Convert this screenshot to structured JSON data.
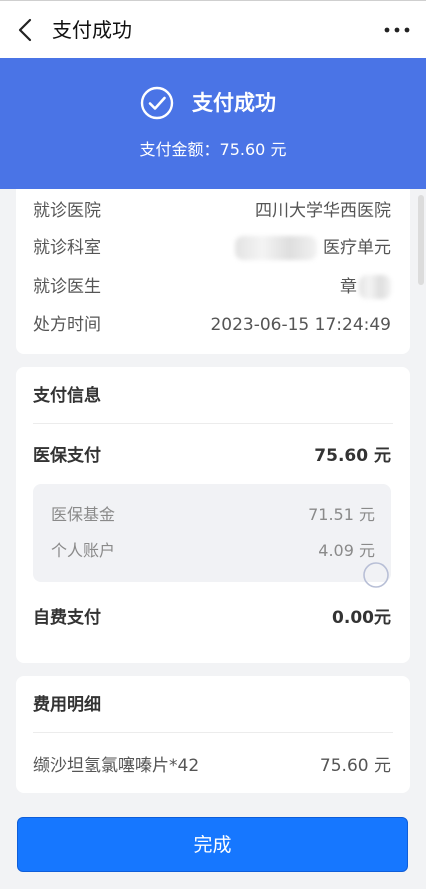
{
  "topbar": {
    "title": "支付成功",
    "back_icon": "chevron-left-icon",
    "more_icon": "more-dots-icon"
  },
  "banner": {
    "title": "支付成功",
    "amount_text": "支付金额：75.60 元",
    "background_color": "#4a74e6",
    "icon": "check-circle-icon"
  },
  "visit": {
    "rows": [
      {
        "label": "就诊医院",
        "value": "四川大学华西医院"
      },
      {
        "label": "就诊科室",
        "value": "医疗单元"
      },
      {
        "label": "就诊医生",
        "value": "章"
      },
      {
        "label": "处方时间",
        "value": "2023-06-15 17:24:49"
      }
    ]
  },
  "payment": {
    "title": "支付信息",
    "insurance_label": "医保支付",
    "insurance_value": "75.60 元",
    "fund_label": "医保基金",
    "fund_value": "71.51 元",
    "personal_label": "个人账户",
    "personal_value": "4.09 元",
    "self_label": "自费支付",
    "self_value": "0.00元"
  },
  "fees": {
    "title": "费用明细",
    "items": [
      {
        "name": "缬沙坦氢氯噻嗪片*42",
        "amount": "75.60 元"
      }
    ]
  },
  "actions": {
    "done_label": "完成",
    "done_color": "#1677ff"
  }
}
